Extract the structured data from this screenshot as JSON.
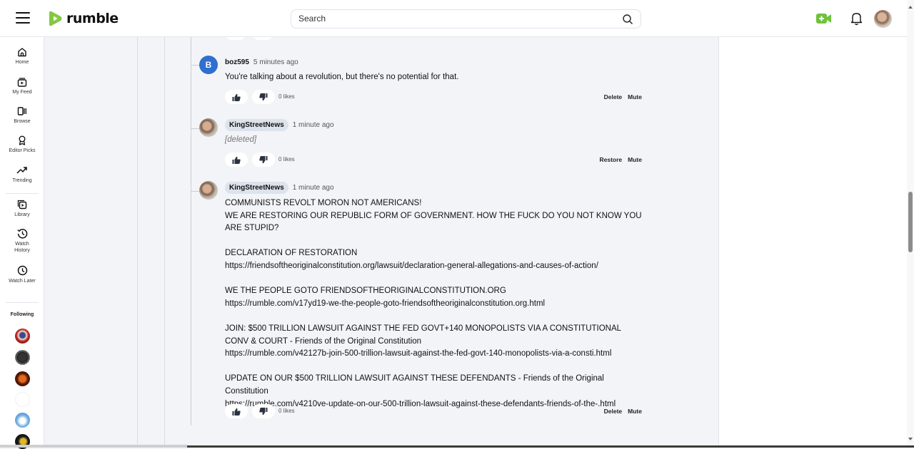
{
  "header": {
    "brand": "rumble",
    "search_placeholder": "Search",
    "search_value": "",
    "brand_color": "#85c742"
  },
  "sidebar": {
    "items": [
      {
        "label": "Home",
        "icon": "home-icon"
      },
      {
        "label": "My Feed",
        "icon": "feed-icon"
      },
      {
        "label": "Browse",
        "icon": "browse-icon"
      },
      {
        "label": "Editor Picks",
        "icon": "award-icon"
      },
      {
        "label": "Trending",
        "icon": "trending-icon"
      },
      {
        "label": "Library",
        "icon": "library-icon"
      },
      {
        "label": "Watch History",
        "icon": "history-icon"
      },
      {
        "label": "Watch Later",
        "icon": "clock-icon"
      }
    ],
    "following_label": "Following",
    "following_count_visible": 6
  },
  "comments": [
    {
      "username": "boz595",
      "avatar_letter": "B",
      "time": "5 minutes ago",
      "body": "You're talking about a revolution, but there's no potential for that.",
      "deleted": false,
      "likes": "0 likes",
      "actions": [
        "Delete",
        "Mute"
      ]
    },
    {
      "username": "KingStreetNews",
      "avatar_letter": "",
      "time": "1 minute ago",
      "body": "[deleted]",
      "deleted": true,
      "likes": "0 likes",
      "actions": [
        "Restore",
        "Mute"
      ]
    },
    {
      "username": "KingStreetNews",
      "avatar_letter": "",
      "time": "1 minute ago",
      "body": "COMMUNISTS REVOLT MORON NOT AMERICANS!\nWE ARE RESTORING OUR REPUBLIC FORM OF GOVERNMENT. HOW THE FUCK DO YOU NOT KNOW YOU ARE STUPID?\n\nDECLARATION OF RESTORATION\nhttps://friendsoftheoriginalconstitution.org/lawsuit/declaration-general-allegations-and-causes-of-action/\n\nWE THE PEOPLE GOTO FRIENDSOFTHEORIGINALCONSTITUTION.ORG\nhttps://rumble.com/v17yd19-we-the-people-goto-friendsoftheoriginalconstitution.org.html\n\nJOIN: $500 TRILLION LAWSUIT AGAINST THE FED GOVT+140 MONOPOLISTS VIA A CONSTITUTIONAL CONV & COURT - Friends of the Original Constitution\nhttps://rumble.com/v42127b-join-500-trillion-lawsuit-against-the-fed-govt-140-monopolists-via-a-consti.html\n\nUPDATE ON OUR $500 TRILLION LAWSUIT AGAINST THESE DEFENDANTS - Friends of the Original Constitution\nhttps://rumble.com/v4210ve-update-on-our-500-trillion-lawsuit-against-these-defendants-friends-of-the-.html",
      "deleted": false,
      "likes": "0 likes",
      "actions": [
        "Delete",
        "Mute"
      ]
    }
  ]
}
